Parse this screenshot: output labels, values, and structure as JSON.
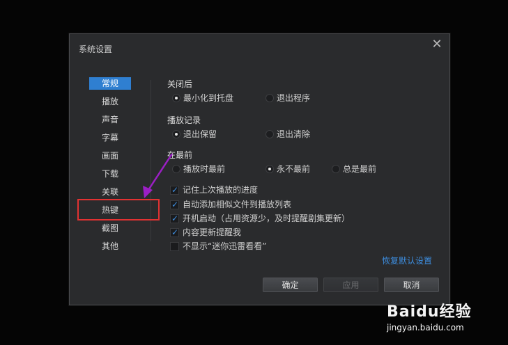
{
  "dialog": {
    "title": "系统设置",
    "close_glyph": "✕"
  },
  "sidebar": {
    "items": [
      {
        "label": "常规",
        "active": true
      },
      {
        "label": "播放"
      },
      {
        "label": "声音"
      },
      {
        "label": "字幕"
      },
      {
        "label": "画面"
      },
      {
        "label": "下载"
      },
      {
        "label": "关联"
      },
      {
        "label": "热键"
      },
      {
        "label": "截图"
      },
      {
        "label": "其他"
      }
    ]
  },
  "close_behavior": {
    "title": "关闭后",
    "options": [
      "最小化到托盘",
      "退出程序"
    ],
    "selected": "最小化到托盘"
  },
  "play_record": {
    "title": "播放记录",
    "options": [
      "退出保留",
      "退出清除"
    ],
    "selected": "退出保留"
  },
  "topmost": {
    "title": "在最前",
    "options": [
      "播放时最前",
      "永不最前",
      "总是最前"
    ],
    "selected": "永不最前"
  },
  "checkboxes": [
    {
      "label": "记住上次播放的进度",
      "checked": true
    },
    {
      "label": "自动添加相似文件到播放列表",
      "checked": true
    },
    {
      "label": "开机启动（占用资源少，及时提醒剧集更新）",
      "checked": true
    },
    {
      "label": "内容更新提醒我",
      "checked": true
    },
    {
      "label": "不显示“迷你迅雷看看”",
      "checked": false
    }
  ],
  "restore_link": "恢复默认设置",
  "buttons": {
    "ok": "确定",
    "apply": "应用",
    "cancel": "取消"
  },
  "watermark": {
    "logo": "Baidu经验",
    "url": "jingyan.baidu.com"
  },
  "colors": {
    "accent": "#2f7fd1",
    "highlight_box": "#e23232",
    "arrow": "#9b1fc4"
  }
}
